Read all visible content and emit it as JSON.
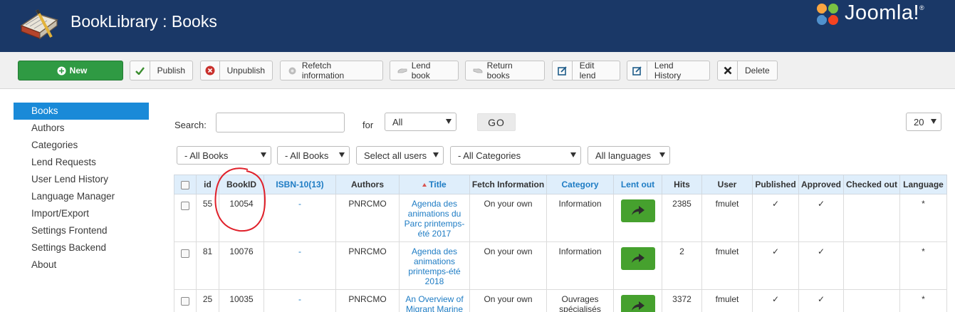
{
  "header": {
    "title": "BookLibrary : Books",
    "brand": "Joomla!",
    "colors": {
      "bar": "#1a3867"
    }
  },
  "toolbar": {
    "new": "New",
    "publish": "Publish",
    "unpublish": "Unpublish",
    "refetch": "Refetch information",
    "lend_book": "Lend book",
    "return_books": "Return books",
    "edit_lend": "Edit lend",
    "lend_history": "Lend History",
    "delete": "Delete"
  },
  "sidebar": {
    "items": [
      {
        "label": "Books",
        "active": true
      },
      {
        "label": "Authors"
      },
      {
        "label": "Categories"
      },
      {
        "label": "Lend Requests"
      },
      {
        "label": "User Lend History"
      },
      {
        "label": "Language Manager"
      },
      {
        "label": "Import/Export"
      },
      {
        "label": "Settings Frontend"
      },
      {
        "label": "Settings Backend"
      },
      {
        "label": "About"
      }
    ]
  },
  "filters": {
    "search_label": "Search:",
    "search_value": "",
    "for_label": "for",
    "for_value": "All",
    "go_label": "GO",
    "page_size": "20",
    "books": "- All Books",
    "books2": "- All Books",
    "users": "Select all users",
    "categories": "- All Categories",
    "languages": "All languages"
  },
  "table": {
    "columns": [
      "id",
      "BookID",
      "ISBN-10(13)",
      "Authors",
      "Title",
      "Fetch Information",
      "Category",
      "Lent out",
      "Hits",
      "User",
      "Published",
      "Approved",
      "Checked out",
      "Language"
    ],
    "rows": [
      {
        "id": "55",
        "bookid": "10054",
        "isbn": "-",
        "authors": "PNRCMO",
        "title": "Agenda des animations du Parc printemps-été 2017",
        "fetch": "On your own",
        "category": "Information",
        "hits": "2385",
        "user": "fmulet",
        "published": "✓",
        "approved": "✓",
        "checked_out": "",
        "language": "*"
      },
      {
        "id": "81",
        "bookid": "10076",
        "isbn": "-",
        "authors": "PNRCMO",
        "title": "Agenda des animations printemps-été 2018",
        "fetch": "On your own",
        "category": "Information",
        "hits": "2",
        "user": "fmulet",
        "published": "✓",
        "approved": "✓",
        "checked_out": "",
        "language": "*"
      },
      {
        "id": "25",
        "bookid": "10035",
        "isbn": "-",
        "authors": "PNRCMO",
        "title": "An Overview of Migrant Marine",
        "fetch": "On your own",
        "category": "Ouvrages spécialisés",
        "hits": "3372",
        "user": "fmulet",
        "published": "✓",
        "approved": "✓",
        "checked_out": "",
        "language": "*"
      }
    ]
  },
  "icons": {
    "publish": "check-icon",
    "unpublish": "x-circle-icon",
    "delete": "x-icon",
    "edit": "edit-icon",
    "lend": "arrow-right-icon"
  },
  "accent": {
    "green": "#2f9a43",
    "blue": "#1a8ad8",
    "link": "#1e7cc4",
    "annotation": "#e0202a"
  }
}
